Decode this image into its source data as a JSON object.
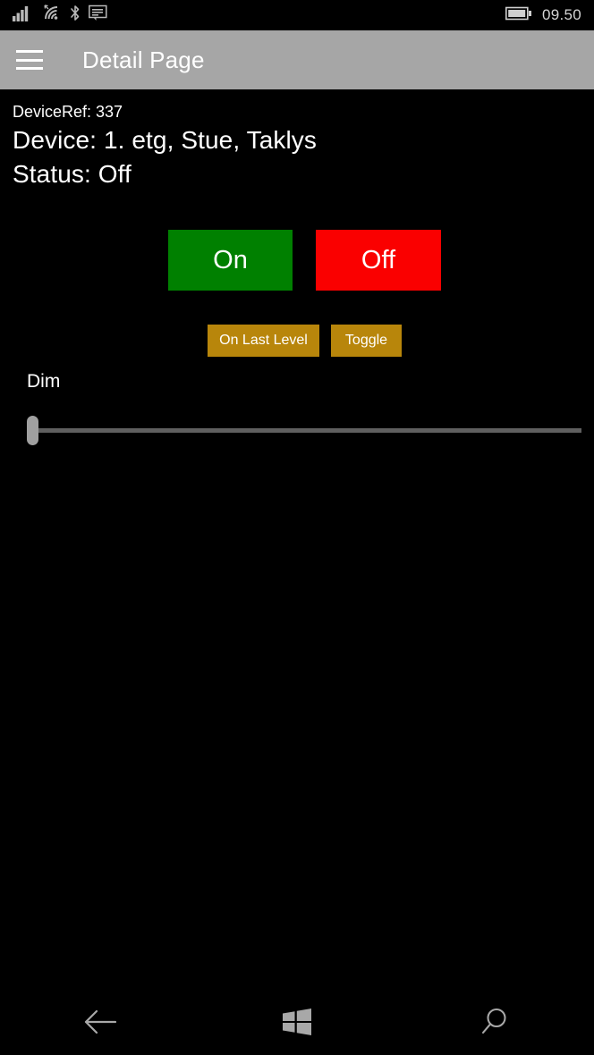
{
  "status_bar": {
    "icons": [
      {
        "name": "cellular-signal-icon",
        "label": "Cellular signal"
      },
      {
        "name": "wifi-icon",
        "label": "Wi-Fi"
      },
      {
        "name": "bluetooth-icon",
        "label": "Bluetooth"
      },
      {
        "name": "sms-message-icon",
        "label": "Messages"
      }
    ],
    "battery_icon": "battery-full-icon",
    "clock": "09.50"
  },
  "title_bar": {
    "menu_icon": "hamburger-menu-icon",
    "title": "Detail Page"
  },
  "device_info": {
    "device_ref": "DeviceRef: 337",
    "device_name": "Device: 1. etg, Stue, Taklys",
    "status": "Status:  Off"
  },
  "primary_buttons": {
    "on_label": "On",
    "off_label": "Off"
  },
  "secondary_buttons": {
    "on_last_level_label": "On Last Level",
    "toggle_label": "Toggle"
  },
  "dim": {
    "label": "Dim",
    "value": 0,
    "min": 0,
    "max": 100
  },
  "nav_bar": {
    "back_icon": "back-arrow-icon",
    "start_icon": "windows-start-icon",
    "search_icon": "search-icon"
  },
  "colors": {
    "background": "#000000",
    "title_bar": "#a6a6a6",
    "on_button": "#008000",
    "off_button": "#fa0000",
    "secondary_button": "#b8860b",
    "text": "#ffffff",
    "slider_track": "#5f5f5f",
    "slider_thumb": "#a0a0a0",
    "nav_icon": "#a8a8a8"
  }
}
